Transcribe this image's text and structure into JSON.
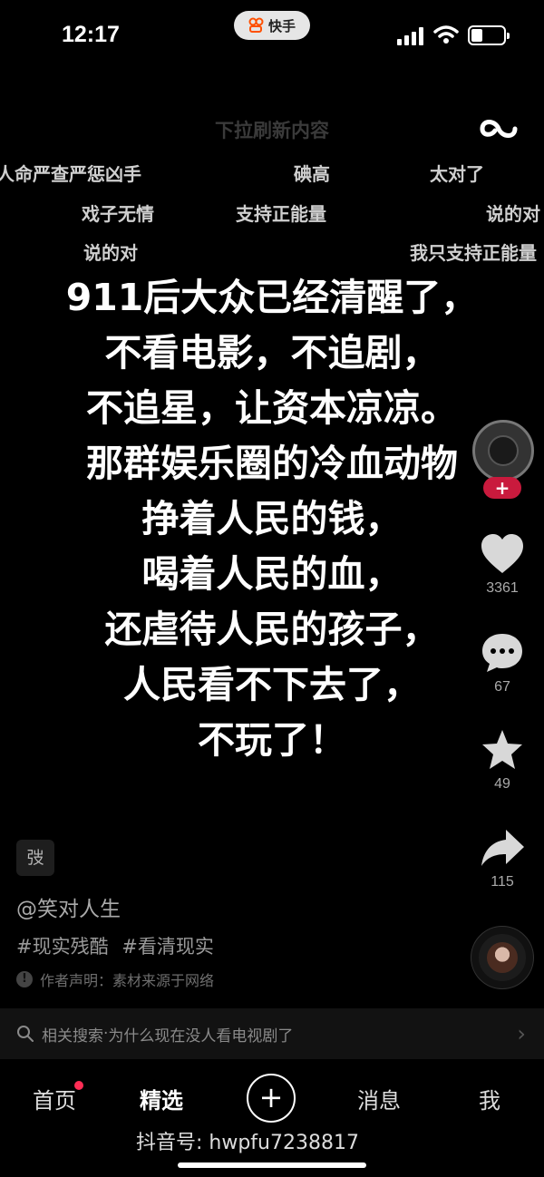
{
  "status": {
    "time": "12:17",
    "app_name": "快手"
  },
  "feed": {
    "refresh_hint": "下拉刷新内容",
    "danmaku": [
      "人命严查严惩凶手",
      "碘高",
      "太对了",
      "戏子无情",
      "支持正能量",
      "说的对",
      "说的对",
      "我只支持正能量"
    ],
    "main_lines": [
      "911后大众已经清醒了，",
      "不看电影，不追剧，",
      "不追星，让资本凉凉。",
      "那群娱乐圈的冷血动物",
      "挣着人民的钱，",
      "喝着人民的血，",
      "还虐待人民的孩子，",
      "人民看不下去了，",
      "不玩了！"
    ]
  },
  "actions": {
    "like_count": "3361",
    "comment_count": "67",
    "favorite_count": "49",
    "share_count": "115"
  },
  "post": {
    "music_badge": "弢",
    "author": "@笑对人生",
    "tags": [
      "#现实残酷",
      "#看清现实"
    ],
    "declaration": "作者声明：素材来源于网络"
  },
  "related_search": {
    "prefix": "相关搜索",
    "query": "为什么现在没人看电视剧了",
    "separator": " · "
  },
  "nav": {
    "home": "首页",
    "featured": "精选",
    "messages": "消息",
    "me": "我"
  },
  "watermark": "抖音号: hwpfu7238817",
  "colors": {
    "background": "#000000",
    "accent_red": "#ff2d55",
    "follow_red": "#c91a3d"
  },
  "icons": [
    "search-icon",
    "heart-icon",
    "comment-icon",
    "star-icon",
    "share-icon",
    "plus-icon",
    "chevron-right-icon"
  ]
}
